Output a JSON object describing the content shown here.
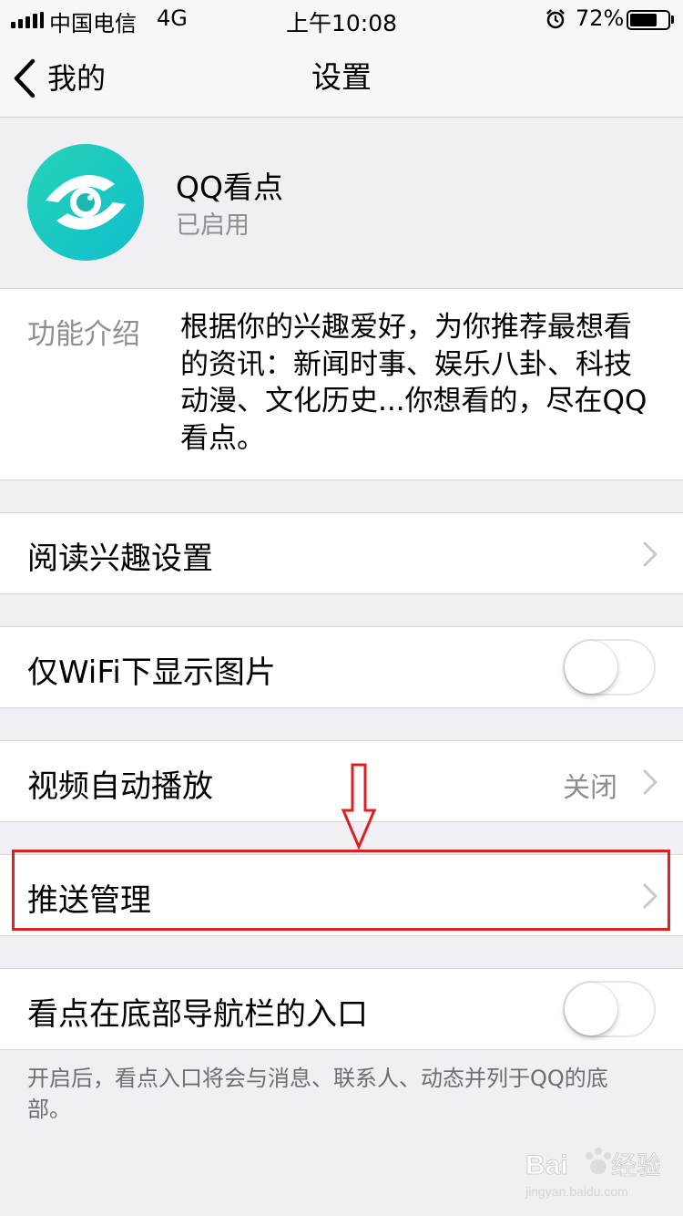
{
  "status_bar": {
    "carrier": "中国电信",
    "network": "4G",
    "time": "上午10:08",
    "battery_percent": "72%",
    "battery_level": 0.72
  },
  "nav": {
    "back_label": "我的",
    "title": "设置"
  },
  "app": {
    "name": "QQ看点",
    "status": "已启用",
    "icon": "eye-icon"
  },
  "intro": {
    "label": "功能介绍",
    "text": "根据你的兴趣爱好，为你推荐最想看的资讯：新闻时事、娱乐八卦、科技动漫、文化历史...你想看的，尽在QQ看点。"
  },
  "rows": {
    "reading_interest": {
      "label": "阅读兴趣设置"
    },
    "wifi_images": {
      "label": "仅WiFi下显示图片",
      "enabled": false
    },
    "video_autoplay": {
      "label": "视频自动播放",
      "value": "关闭"
    },
    "push_management": {
      "label": "推送管理"
    },
    "bottom_nav_entry": {
      "label": "看点在底部导航栏的入口",
      "enabled": false
    }
  },
  "footer_note": "开启后，看点入口将会与消息、联系人、动态并列于QQ的底部。",
  "annotation": {
    "color": "#e02020"
  },
  "watermark": {
    "brand": "Bai du 经验",
    "site": "jingyan.baidu.com"
  }
}
